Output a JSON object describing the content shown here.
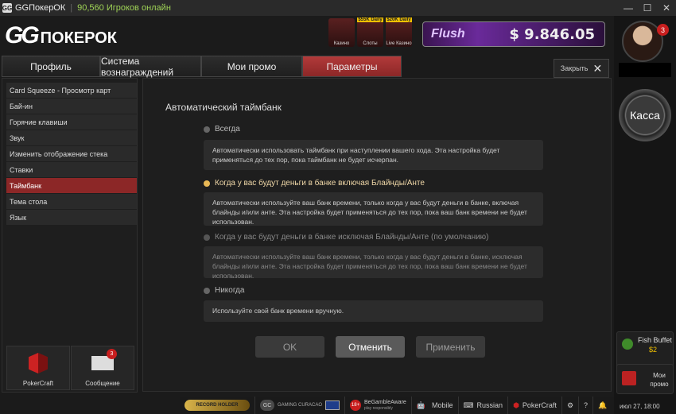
{
  "titlebar": {
    "app_name": "GGПокерОК",
    "online": "90,560 Игроков онлайн",
    "minimize": "—",
    "maximize": "☐",
    "close": "✕"
  },
  "header": {
    "logo_gg": "GG",
    "logo_text": "ПОКЕРОК",
    "games": [
      {
        "label": "Казино",
        "badge": ""
      },
      {
        "label": "Слоты",
        "badge": "$55K Daily"
      },
      {
        "label": "Live Казино",
        "badge": "$20K Daily"
      }
    ],
    "flush_name": "Flush",
    "flush_amount": "$ 9.846.05"
  },
  "tabs": [
    {
      "label": "Профиль",
      "active": false
    },
    {
      "label": "Система вознаграждений",
      "active": false
    },
    {
      "label": "Мои промо",
      "active": false
    },
    {
      "label": "Параметры",
      "active": true
    }
  ],
  "close_button": {
    "label": "Закрыть",
    "icon": "✕"
  },
  "menu": [
    {
      "label": "Card Squeeze - Просмотр карт",
      "active": false
    },
    {
      "label": "Бай-ин",
      "active": false
    },
    {
      "label": "Горячие клавиши",
      "active": false
    },
    {
      "label": "Звук",
      "active": false
    },
    {
      "label": "Изменить отображение стека",
      "active": false
    },
    {
      "label": "Ставки",
      "active": false
    },
    {
      "label": "Таймбанк",
      "active": true
    },
    {
      "label": "Тема стола",
      "active": false
    },
    {
      "label": "Язык",
      "active": false
    }
  ],
  "bottom_buttons": {
    "pokercraft": "PokerCraft",
    "messages": "Сообщение",
    "messages_badge": "3"
  },
  "main": {
    "title": "Автоматический таймбанк",
    "options": [
      {
        "label": "Всегда",
        "state": "normal",
        "desc": "Автоматически использовать таймбанк при наступлении вашего хода. Эта настройка будет применяться до тех пор, пока таймбанк не будет исчерпан."
      },
      {
        "label": "Когда у вас будут деньги в банке включая Блайнды/Анте",
        "state": "selected",
        "desc": "Автоматически используйте ваш банк времени, только когда у вас будут деньги в банке, включая блайнды и/или анте. Эта настройка будет применяться до тех пор, пока ваш банк времени не будет использован."
      },
      {
        "label": "Когда у вас будут деньги в банке исключая Блайнды/Анте (по умолчанию)",
        "state": "disabled",
        "desc": "Автоматически используйте ваш банк времени, только когда у вас будут деньги в банке, исключая блайнды и/или анте. Эта настройка будет применяться до тех пор, пока ваш банк времени не будет использован."
      },
      {
        "label": "Никогда",
        "state": "normal",
        "desc": "Используйте свой банк времени вручную."
      }
    ],
    "ok": "OK",
    "cancel": "Отменить",
    "apply": "Применить"
  },
  "right": {
    "avatar_badge": "3",
    "kassa": "Касса",
    "fish_title": "Fish Buffet",
    "fish_amount": "$2",
    "promo": "Мои промо"
  },
  "status": {
    "record": "RECORD HOLDER",
    "gaming_badge": "GC",
    "gaming": "GAMING CURACAO",
    "age": "18+",
    "begamble": "BeGambleAware",
    "begamble_sub": "play responsibly",
    "mobile": "Mobile",
    "language": "Russian",
    "pokercraft": "PokerCraft",
    "date": "июл 27, 18:00"
  },
  "colors": {
    "accent": "#8c2727",
    "selected_radio": "#e8b855",
    "online": "#9fd356"
  }
}
